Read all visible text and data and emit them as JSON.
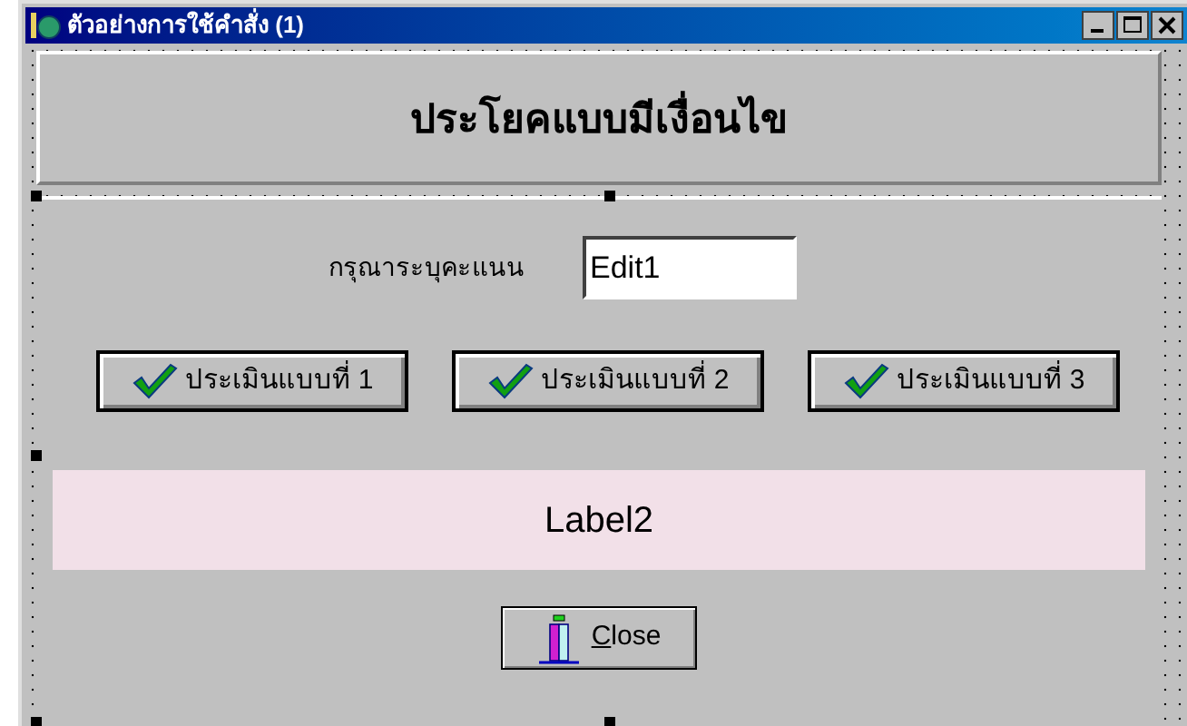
{
  "window": {
    "title": "ตัวอย่างการใช้คำสั่ง (1)"
  },
  "header_panel": {
    "caption": "ประโยคแบบมีเงื่อนไข"
  },
  "score_field": {
    "label": "กรุณาระบุคะแนน",
    "value": "Edit1"
  },
  "buttons": [
    {
      "label": "ประเมินแบบที่ 1"
    },
    {
      "label": "ประเมินแบบที่ 2"
    },
    {
      "label": "ประเมินแบบที่ 3"
    }
  ],
  "result_label": {
    "text": "Label2"
  },
  "close_button": {
    "mnemonic": "C",
    "rest": "lose"
  }
}
